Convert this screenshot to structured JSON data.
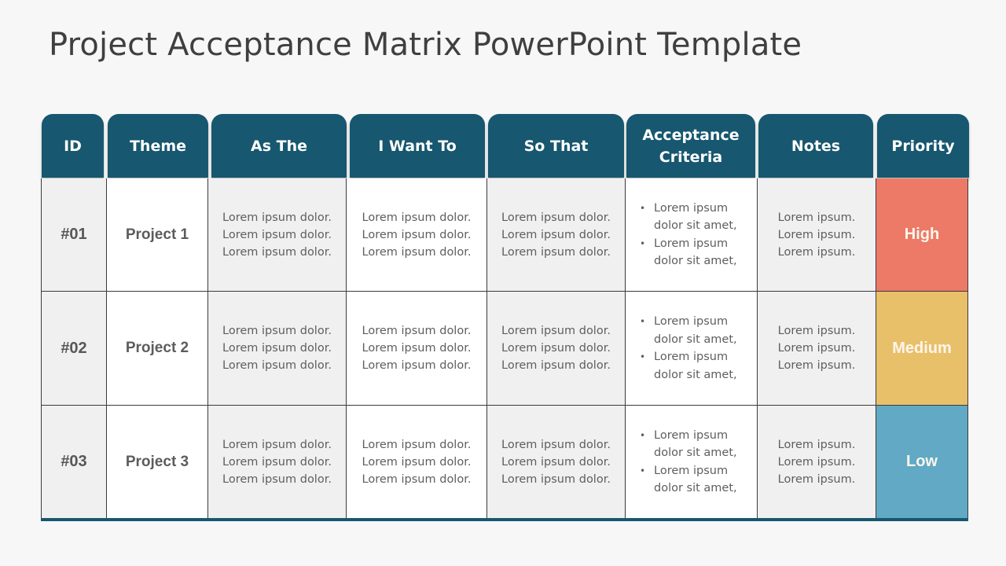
{
  "title": "Project Acceptance Matrix PowerPoint Template",
  "columns": [
    {
      "key": "id",
      "label": "ID"
    },
    {
      "key": "theme",
      "label": "Theme"
    },
    {
      "key": "as_the",
      "label": "As The"
    },
    {
      "key": "i_want_to",
      "label": "I Want To"
    },
    {
      "key": "so_that",
      "label": "So That"
    },
    {
      "key": "acceptance_criteria",
      "label": "Acceptance Criteria"
    },
    {
      "key": "notes",
      "label": "Notes"
    },
    {
      "key": "priority",
      "label": "Priority"
    }
  ],
  "colors": {
    "header": "#17576f",
    "high": "#ec7a66",
    "medium": "#e9c06a",
    "low": "#61a9c4"
  },
  "rows": [
    {
      "id": "#01",
      "theme": "Project 1",
      "as_the": [
        "Lorem ipsum dolor.",
        "Lorem ipsum dolor.",
        "Lorem ipsum dolor."
      ],
      "i_want_to": [
        "Lorem ipsum dolor.",
        "Lorem ipsum dolor.",
        "Lorem ipsum dolor."
      ],
      "so_that": [
        "Lorem ipsum dolor.",
        "Lorem ipsum dolor.",
        "Lorem ipsum dolor."
      ],
      "acceptance_criteria": [
        "Lorem ipsum dolor sit amet,",
        "Lorem ipsum dolor sit amet,"
      ],
      "notes": [
        "Lorem ipsum.",
        "Lorem ipsum.",
        "Lorem ipsum."
      ],
      "priority": "High",
      "priority_level": "high"
    },
    {
      "id": "#02",
      "theme": "Project 2",
      "as_the": [
        "Lorem ipsum dolor.",
        "Lorem ipsum dolor.",
        "Lorem ipsum dolor."
      ],
      "i_want_to": [
        "Lorem ipsum dolor.",
        "Lorem ipsum dolor.",
        "Lorem ipsum dolor."
      ],
      "so_that": [
        "Lorem ipsum dolor.",
        "Lorem ipsum dolor.",
        "Lorem ipsum dolor."
      ],
      "acceptance_criteria": [
        "Lorem ipsum dolor sit amet,",
        "Lorem ipsum dolor sit amet,"
      ],
      "notes": [
        "Lorem ipsum.",
        "Lorem ipsum.",
        "Lorem ipsum."
      ],
      "priority": "Medium",
      "priority_level": "medium"
    },
    {
      "id": "#03",
      "theme": "Project 3",
      "as_the": [
        "Lorem ipsum dolor.",
        "Lorem ipsum dolor.",
        "Lorem ipsum dolor."
      ],
      "i_want_to": [
        "Lorem ipsum dolor.",
        "Lorem ipsum dolor.",
        "Lorem ipsum dolor."
      ],
      "so_that": [
        "Lorem ipsum dolor.",
        "Lorem ipsum dolor.",
        "Lorem ipsum dolor."
      ],
      "acceptance_criteria": [
        "Lorem ipsum dolor sit amet,",
        "Lorem ipsum dolor sit amet,"
      ],
      "notes": [
        "Lorem ipsum.",
        "Lorem ipsum.",
        "Lorem ipsum."
      ],
      "priority": "Low",
      "priority_level": "low"
    }
  ]
}
